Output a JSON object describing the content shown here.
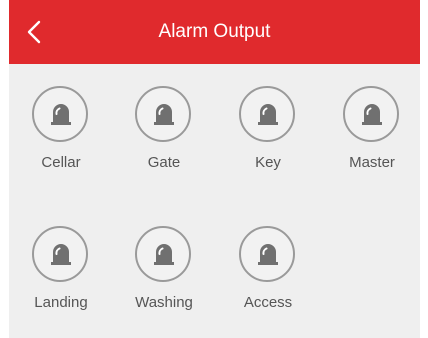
{
  "header": {
    "title": "Alarm Output",
    "back_icon": "chevron-left-icon",
    "background_color": "#e02a2d"
  },
  "outputs": [
    {
      "label": "Cellar",
      "icon": "alarm-siren-icon"
    },
    {
      "label": "Gate",
      "icon": "alarm-siren-icon"
    },
    {
      "label": "Key",
      "icon": "alarm-siren-icon"
    },
    {
      "label": "Master",
      "icon": "alarm-siren-icon"
    },
    {
      "label": "Landing",
      "icon": "alarm-siren-icon"
    },
    {
      "label": "Washing",
      "icon": "alarm-siren-icon"
    },
    {
      "label": "Access",
      "icon": "alarm-siren-icon"
    }
  ]
}
